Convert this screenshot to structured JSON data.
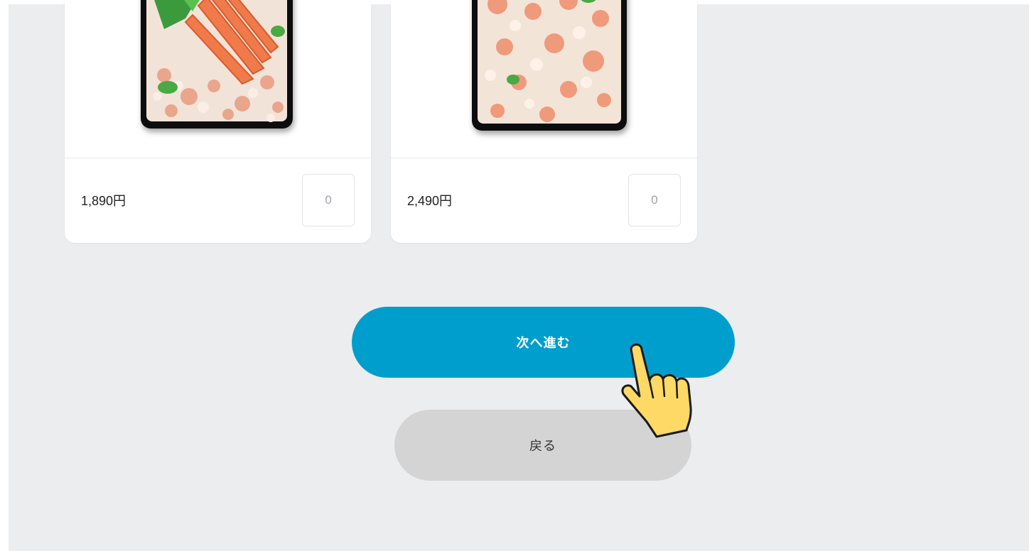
{
  "products": [
    {
      "price": "1,890円",
      "quantity": "0",
      "image": "crab-leg-bento-image"
    },
    {
      "price": "2,490円",
      "quantity": "0",
      "image": "crab-meat-bento-image"
    }
  ],
  "actions": {
    "next_label": "次へ進む",
    "back_label": "戻る"
  },
  "colors": {
    "background": "#ecedef",
    "next_button": "#009ecc",
    "back_button": "#d4d4d4",
    "cursor": "#ffd966"
  },
  "icons": {
    "cursor": "pointing-hand-icon"
  }
}
